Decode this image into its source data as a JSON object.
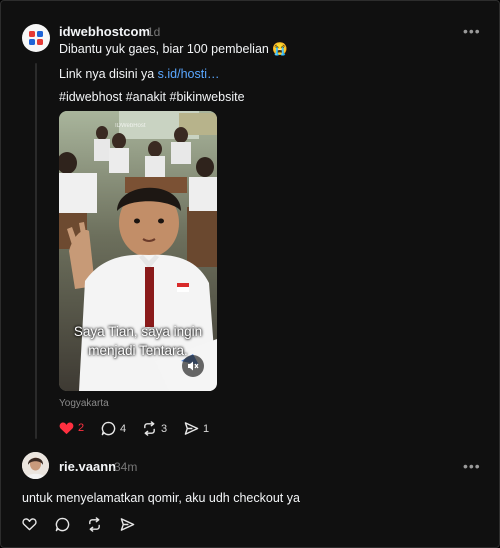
{
  "post": {
    "username": "idwebhostcom",
    "time": "1d",
    "more": "•••",
    "line1": "Dibantu yuk gaes, biar 100 pembelian 😭",
    "line2_prefix": "Link nya disini ya ",
    "line2_link": "s.id/hosti…",
    "hashtags": "#idwebhost #anakit #bikinwebsite",
    "video_caption_line1": "Saya Tian, saya ingin",
    "video_caption_line2": "menjadi Tentara.",
    "location": "Yogyakarta",
    "likes": "2",
    "comments": "4",
    "reposts": "3",
    "shares": "1",
    "like_color": "#ff3040"
  },
  "reply": {
    "username": "rie.vaann",
    "time": "34m",
    "more": "•••",
    "text": "untuk menyelamatkan qomir, aku udh checkout ya"
  },
  "icons": {
    "like": "heart-icon",
    "comment": "speech-bubble-icon",
    "repost": "repost-icon",
    "share": "send-icon",
    "mute": "speaker-muted-icon"
  }
}
